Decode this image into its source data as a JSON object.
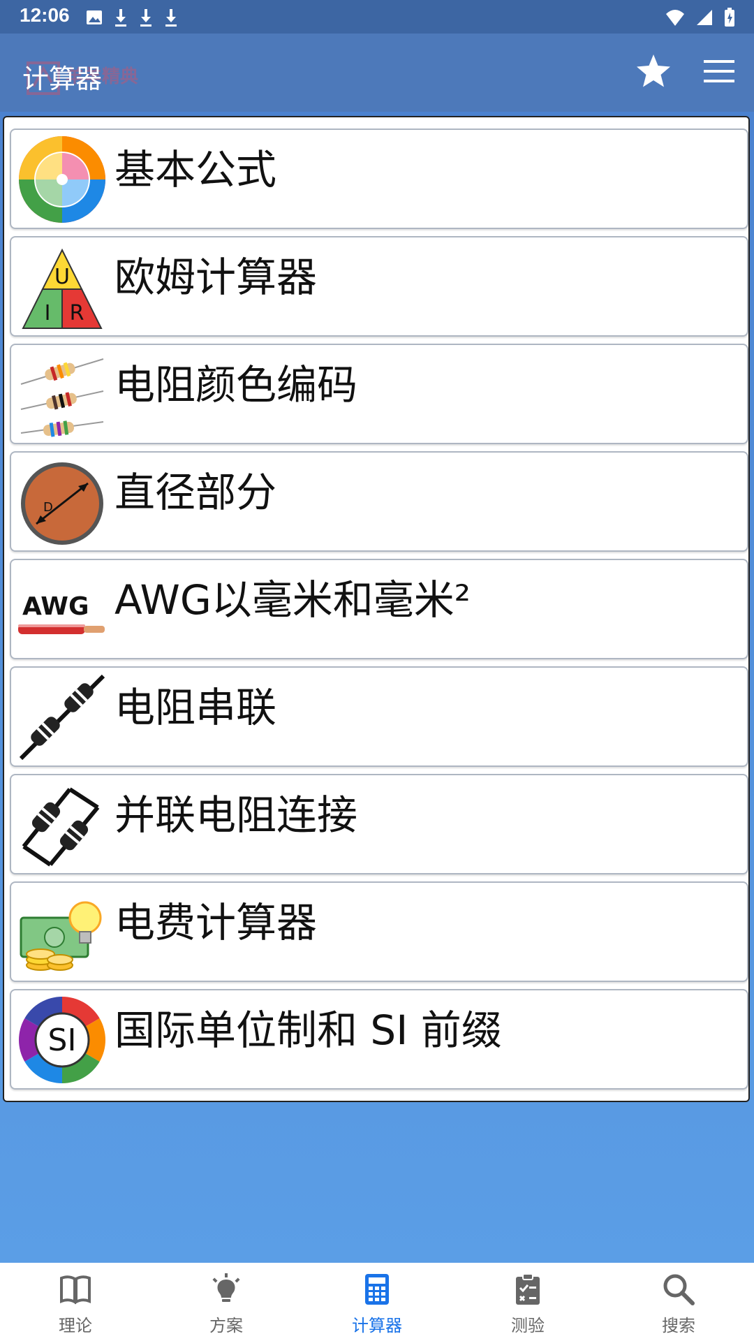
{
  "status_bar": {
    "time": "12:06",
    "left_icons": [
      "image-icon",
      "download-icon",
      "download-icon",
      "download-icon"
    ],
    "right_icons": [
      "wifi-icon",
      "cell-signal-icon",
      "battery-icon"
    ]
  },
  "app_bar": {
    "watermark": "羊羊精典",
    "title": "计算器",
    "favorite_icon": "star-icon",
    "menu_icon": "menu-icon"
  },
  "calculators": [
    {
      "label": "基本公式",
      "icon": "pie-formula-icon"
    },
    {
      "label": "欧姆计算器",
      "icon": "ohm-triangle-icon"
    },
    {
      "label": "电阻颜色编码",
      "icon": "resistor-color-icon"
    },
    {
      "label": "直径部分",
      "icon": "diameter-icon"
    },
    {
      "label": "AWG以毫米和毫米²",
      "icon": "awg-wire-icon"
    },
    {
      "label": "电阻串联",
      "icon": "series-resistor-icon"
    },
    {
      "label": "并联电阻连接",
      "icon": "parallel-resistor-icon"
    },
    {
      "label": "电费计算器",
      "icon": "electricity-cost-icon"
    },
    {
      "label": "国际单位制和 SI 前缀",
      "icon": "si-units-icon"
    }
  ],
  "icon_text": {
    "ohm": [
      "U",
      "I",
      "R"
    ],
    "diameter": "D",
    "awg": "AWG",
    "si": "SI"
  },
  "bottom_nav": {
    "items": [
      {
        "label": "理论",
        "icon": "book-icon",
        "active": false
      },
      {
        "label": "方案",
        "icon": "lightbulb-icon",
        "active": false
      },
      {
        "label": "计算器",
        "icon": "calculator-icon",
        "active": true
      },
      {
        "label": "测验",
        "icon": "quiz-clipboard-icon",
        "active": false
      },
      {
        "label": "搜索",
        "icon": "search-icon",
        "active": false
      }
    ]
  },
  "colors": {
    "status_bar": "#3d66a3",
    "app_bar": "#4d79ba",
    "nav_active": "#1a73e8",
    "nav_inactive": "#666666"
  }
}
